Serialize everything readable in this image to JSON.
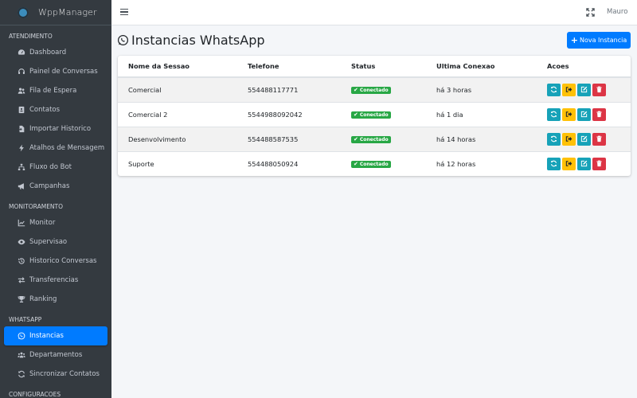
{
  "brand": {
    "title": "WppManager"
  },
  "sidebar": {
    "sections": [
      {
        "header": "ATENDIMENTO",
        "items": [
          {
            "label": "Dashboard",
            "icon": "dashboard-icon"
          },
          {
            "label": "Painel de Conversas",
            "icon": "headset-icon"
          },
          {
            "label": "Fila de Espera",
            "icon": "users-icon"
          },
          {
            "label": "Contatos",
            "icon": "contact-book-icon"
          },
          {
            "label": "Importar Historico",
            "icon": "file-import-icon"
          },
          {
            "label": "Atalhos de Mensagem",
            "icon": "bolt-icon"
          },
          {
            "label": "Fluxo do Bot",
            "icon": "sitemap-icon"
          },
          {
            "label": "Campanhas",
            "icon": "bullhorn-icon"
          }
        ]
      },
      {
        "header": "MONITORAMENTO",
        "items": [
          {
            "label": "Monitor",
            "icon": "chart-line-icon"
          },
          {
            "label": "Supervisao",
            "icon": "eye-icon"
          },
          {
            "label": "Historico Conversas",
            "icon": "history-icon"
          },
          {
            "label": "Transferencias",
            "icon": "exchange-icon"
          },
          {
            "label": "Ranking",
            "icon": "trophy-icon"
          }
        ]
      },
      {
        "header": "WHATSAPP",
        "items": [
          {
            "label": "Instancias",
            "icon": "whatsapp-icon",
            "active": true
          },
          {
            "label": "Departamentos",
            "icon": "users-group-icon"
          },
          {
            "label": "Sincronizar Contatos",
            "icon": "sync-icon"
          }
        ]
      },
      {
        "header": "CONFIGURACOES",
        "items": []
      }
    ]
  },
  "topbar": {
    "user": "Mauro"
  },
  "main": {
    "title": "Instancias WhatsApp",
    "new_button": "Nova Instancia",
    "table": {
      "columns": [
        "Nome da Sessao",
        "Telefone",
        "Status",
        "Ultima Conexao",
        "Acoes"
      ],
      "rows": [
        {
          "name": "Comercial",
          "phone": "554488117771",
          "status": "Conectado",
          "last": "há 3 horas"
        },
        {
          "name": "Comercial 2",
          "phone": "5544988092042",
          "status": "Conectado",
          "last": "há 1 dia"
        },
        {
          "name": "Desenvolvimento",
          "phone": "554488587535",
          "status": "Conectado",
          "last": "há 14 horas"
        },
        {
          "name": "Suporte",
          "phone": "554488050924",
          "status": "Conectado",
          "last": "há 12 horas"
        }
      ]
    }
  },
  "colors": {
    "primary": "#007bff",
    "sidebar": "#343a40",
    "success": "#28a745",
    "info": "#17a2b8",
    "warning": "#ffc107",
    "danger": "#dc3545"
  }
}
